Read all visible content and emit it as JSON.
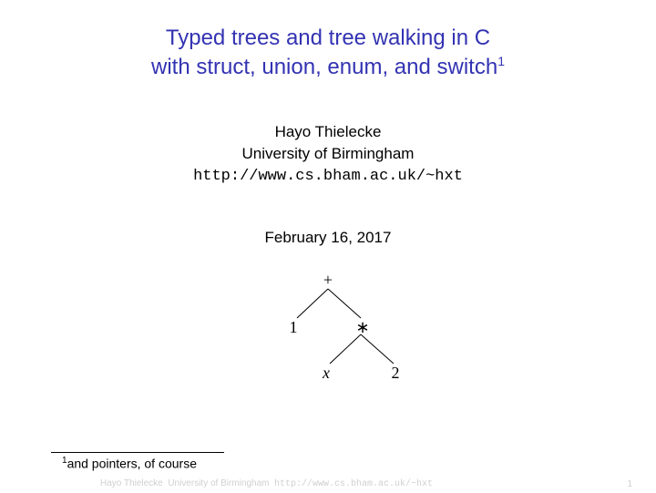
{
  "title": {
    "line1": "Typed trees and tree walking in C",
    "line2_pre": "with struct, union, enum, and switch",
    "line2_sup": "1"
  },
  "author": {
    "name": "Hayo Thielecke",
    "affiliation": "University of Birmingham",
    "url": "http://www.cs.bham.ac.uk/~hxt"
  },
  "date": "February 16, 2017",
  "tree": {
    "root": "+",
    "left": "1",
    "right": "∗",
    "right_left": "x",
    "right_right": "2"
  },
  "footnote": {
    "mark": "1",
    "text": "and pointers, of course"
  },
  "footer": {
    "author": "Hayo Thielecke",
    "affiliation": "University of Birmingham",
    "url": "http://www.cs.bham.ac.uk/~hxt",
    "page": "1"
  }
}
